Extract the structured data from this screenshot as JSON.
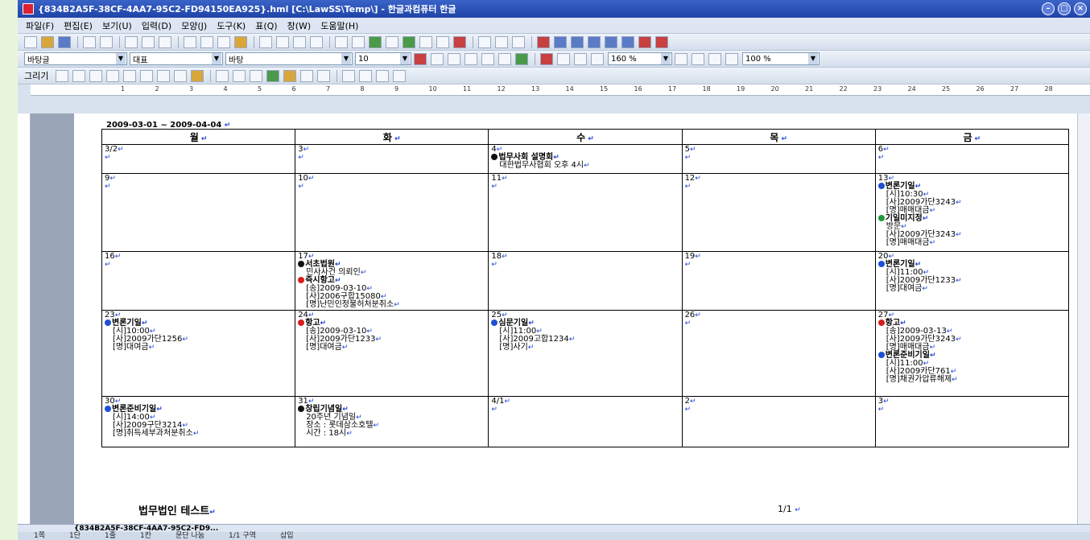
{
  "window": {
    "title": "{834B2A5F-38CF-4AA7-95C2-FD94150EA925}.hml [C:\\LawSS\\Temp\\] - 한글과컴퓨터 한글"
  },
  "menu": [
    "파일(F)",
    "편집(E)",
    "보기(U)",
    "입력(D)",
    "모양(J)",
    "도구(K)",
    "표(Q)",
    "창(W)",
    "도움말(H)"
  ],
  "format_toolbar": {
    "style": "바탕글",
    "font_kind": "대표",
    "font": "바탕",
    "size": "10",
    "line_spacing": "160 %",
    "zoom": "100 %"
  },
  "draw_toolbar_label": "그리기",
  "ruler_ticks": [
    "1",
    "2",
    "3",
    "4",
    "5",
    "6",
    "7",
    "8",
    "9",
    "10",
    "11",
    "12",
    "13",
    "14",
    "15",
    "16",
    "17",
    "18",
    "19",
    "20",
    "21",
    "22",
    "23",
    "24",
    "25",
    "26",
    "27",
    "28"
  ],
  "calendar": {
    "date_range": "2009-03-01 ~ 2009-04-04",
    "weekdays": [
      "월",
      "화",
      "수",
      "목",
      "금"
    ],
    "rows": [
      [
        {
          "day": "3/2",
          "events": []
        },
        {
          "day": "3",
          "events": []
        },
        {
          "day": "4",
          "events": [
            {
              "marker": "black",
              "title": "법무사회 설명회",
              "lines": [
                "대한법무사협회 오후 4시"
              ]
            }
          ]
        },
        {
          "day": "5",
          "events": []
        },
        {
          "day": "6",
          "events": []
        }
      ],
      [
        {
          "day": "9",
          "events": []
        },
        {
          "day": "10",
          "events": []
        },
        {
          "day": "11",
          "events": []
        },
        {
          "day": "12",
          "events": []
        },
        {
          "day": "13",
          "events": [
            {
              "marker": "blue",
              "title": "변론기일",
              "lines": [
                "[시]10:30",
                "[사]2009가단3243",
                "[명]매매대금"
              ]
            },
            {
              "marker": "green",
              "title": "기일미지정",
              "lines": [
                "방문",
                "[사]2009가단3243",
                "[명]매매대금"
              ]
            }
          ]
        }
      ],
      [
        {
          "day": "16",
          "events": []
        },
        {
          "day": "17",
          "events": [
            {
              "marker": "black",
              "title": "서초법원",
              "lines": [
                "민사사건 의뢰인"
              ]
            },
            {
              "marker": "red",
              "title": "즉시항고",
              "lines": [
                "[송]2009-03-10",
                "[사]2006구합15080",
                "[명]난민인정불허처분취소"
              ]
            }
          ]
        },
        {
          "day": "18",
          "events": []
        },
        {
          "day": "19",
          "events": []
        },
        {
          "day": "20",
          "events": [
            {
              "marker": "blue",
              "title": "변론기일",
              "lines": [
                "[시]11:00",
                "[사]2009가단1233",
                "[명]대여금"
              ]
            }
          ]
        }
      ],
      [
        {
          "day": "23",
          "events": [
            {
              "marker": "blue",
              "title": "변론기일",
              "lines": [
                "[시]10:00",
                "[사]2009가단1256",
                "[명]대여금"
              ]
            }
          ]
        },
        {
          "day": "24",
          "events": [
            {
              "marker": "red",
              "title": "항고",
              "lines": [
                "[송]2009-03-10",
                "[사]2009가단1233",
                "[명]대여금"
              ]
            }
          ]
        },
        {
          "day": "25",
          "events": [
            {
              "marker": "blue",
              "title": "심문기일",
              "lines": [
                "[시]11:00",
                "[사]2009고합1234",
                "[명]사기"
              ]
            }
          ]
        },
        {
          "day": "26",
          "events": []
        },
        {
          "day": "27",
          "events": [
            {
              "marker": "red",
              "title": "항고",
              "lines": [
                "[송]2009-03-13",
                "[사]2009가단3243",
                "[명]매매대금"
              ]
            },
            {
              "marker": "blue",
              "title": "변론준비기일",
              "lines": [
                "[시]11:00",
                "[사]2009카단761",
                "[명]채권가압류해제"
              ]
            }
          ]
        }
      ],
      [
        {
          "day": "30",
          "events": [
            {
              "marker": "blue",
              "title": "변론준비기일",
              "lines": [
                "[시]14:00",
                "[사]2009구단3214",
                "[명]취득세부과처분취소"
              ]
            }
          ]
        },
        {
          "day": "31",
          "events": [
            {
              "marker": "black",
              "title": "창립기념일",
              "lines": [
                "20주년 기념일",
                "장소 : 롯데삼소호텔",
                "시간 : 18시"
              ]
            }
          ]
        },
        {
          "day": "4/1",
          "events": []
        },
        {
          "day": "2",
          "events": []
        },
        {
          "day": "3",
          "events": []
        }
      ]
    ]
  },
  "footer": {
    "org": "법무법인 테스트",
    "page": "1/1"
  },
  "doc_tab": "{834B2A5F-38CF-4AA7-95C2-FD9...",
  "status": [
    "1쪽",
    "1단",
    "1줄",
    "1칸",
    "문단 나눔",
    "1/1 구역",
    "삽입"
  ]
}
